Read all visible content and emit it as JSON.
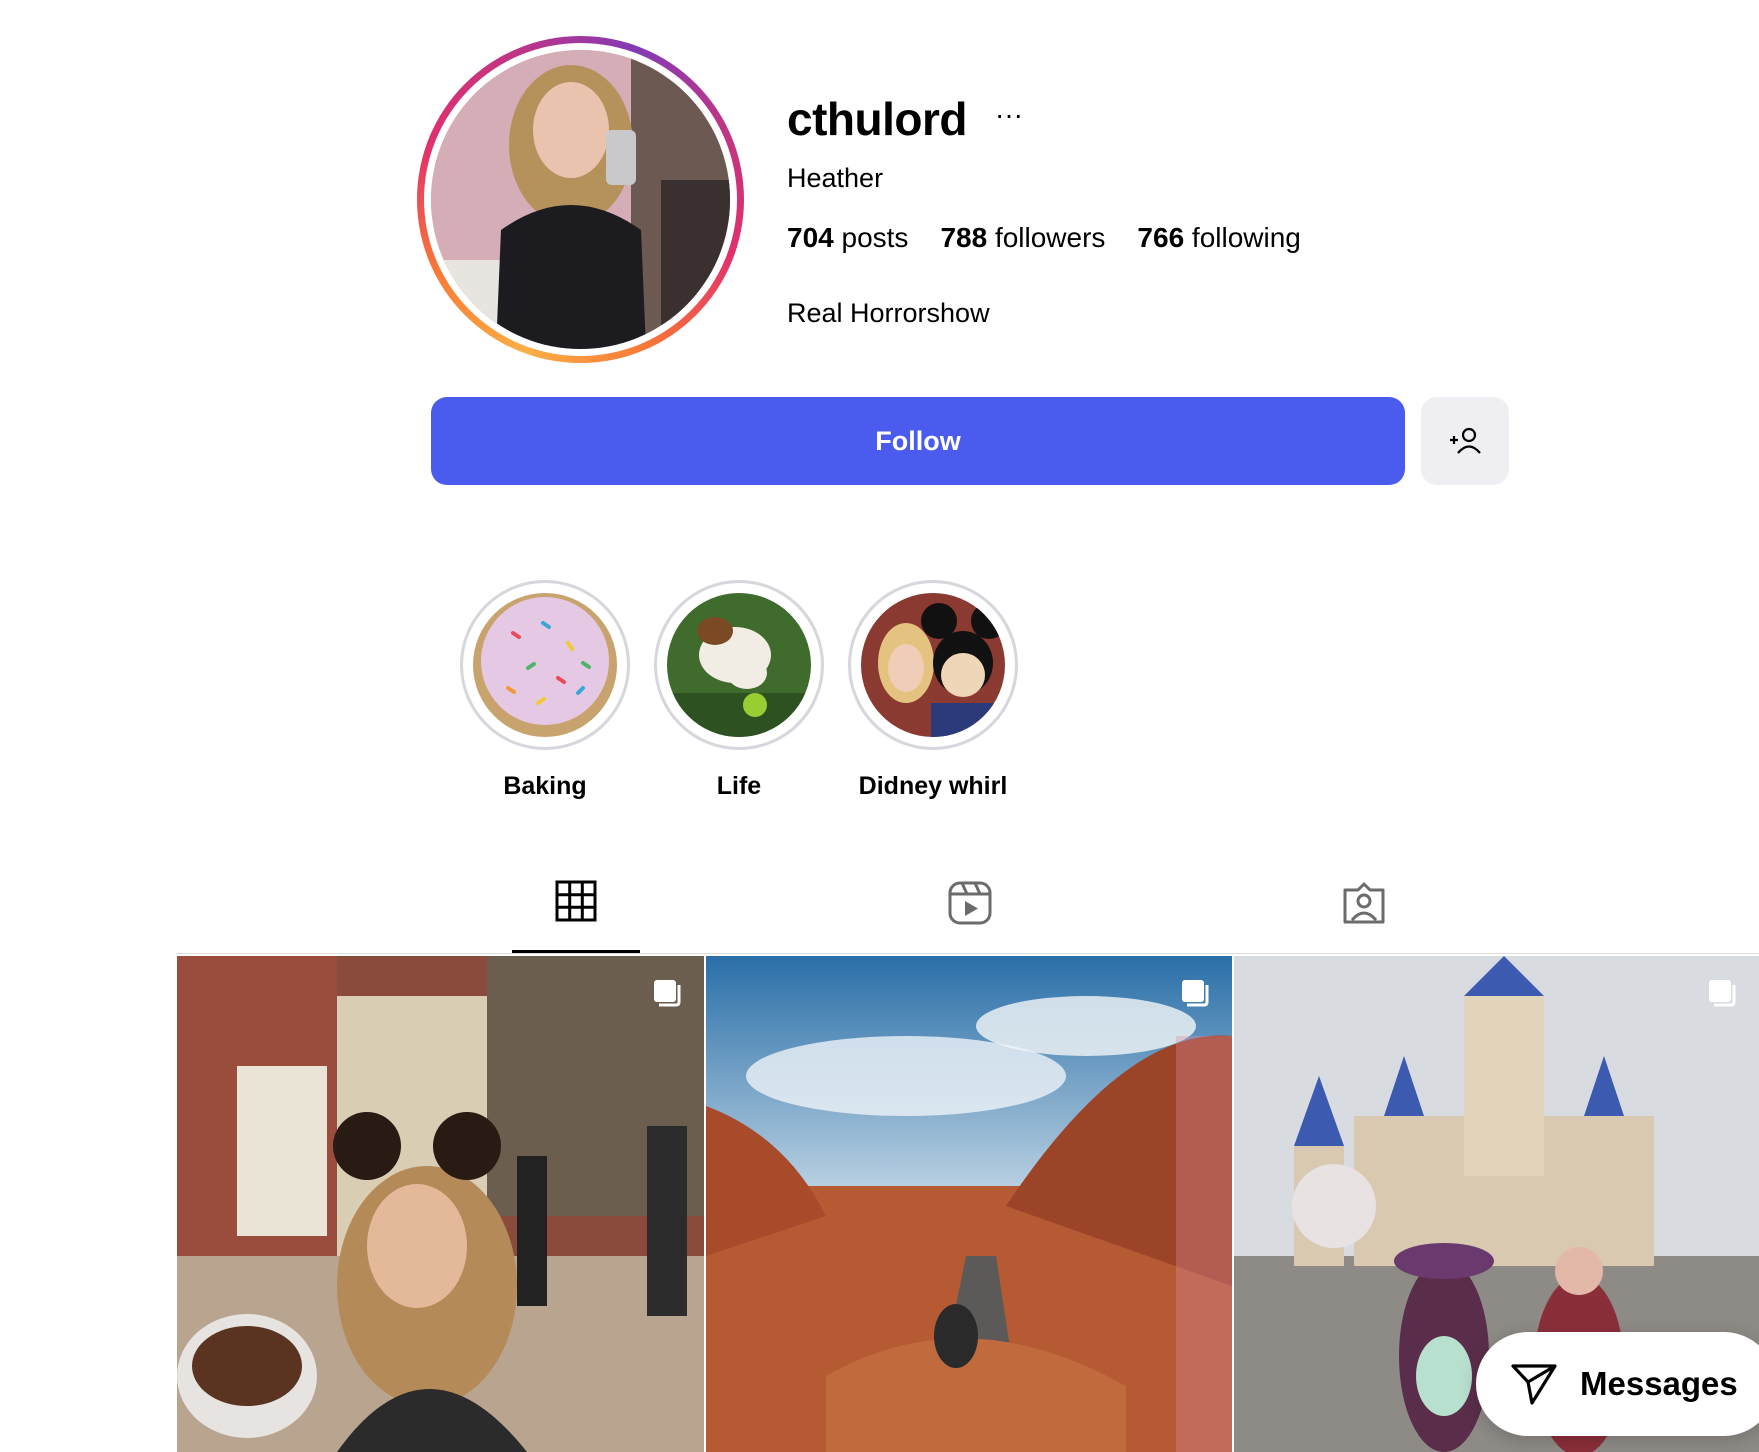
{
  "profile": {
    "username": "cthulord",
    "more": "···",
    "full_name": "Heather",
    "bio": "Real Horrorshow",
    "stats": [
      {
        "value": "704",
        "label": "posts"
      },
      {
        "value": "788",
        "label": "followers"
      },
      {
        "value": "766",
        "label": "following"
      }
    ]
  },
  "actions": {
    "follow_label": "Follow",
    "suggest_icon": "add-person-icon"
  },
  "highlights": [
    {
      "label": "Baking",
      "icon": "sprinkle-cake-photo"
    },
    {
      "label": "Life",
      "icon": "dog-photo"
    },
    {
      "label": "Didney whirl",
      "icon": "mickey-photo"
    }
  ],
  "tabs": [
    {
      "icon": "grid-icon",
      "active": true
    },
    {
      "icon": "reels-icon",
      "active": false
    },
    {
      "icon": "tagged-icon",
      "active": false
    }
  ],
  "posts": [
    {
      "icon": "carousel-icon",
      "subject": "disney-epcot-selfie-photo"
    },
    {
      "icon": "carousel-icon",
      "subject": "red-rock-desert-photo"
    },
    {
      "icon": "carousel-icon",
      "subject": "castle-costume-photo"
    }
  ],
  "messages": {
    "label": "Messages",
    "icon": "paper-plane-icon"
  },
  "colors": {
    "follow": "#4a5bed",
    "secondary_button": "#efeff3",
    "accent_ring": "#c13584"
  }
}
